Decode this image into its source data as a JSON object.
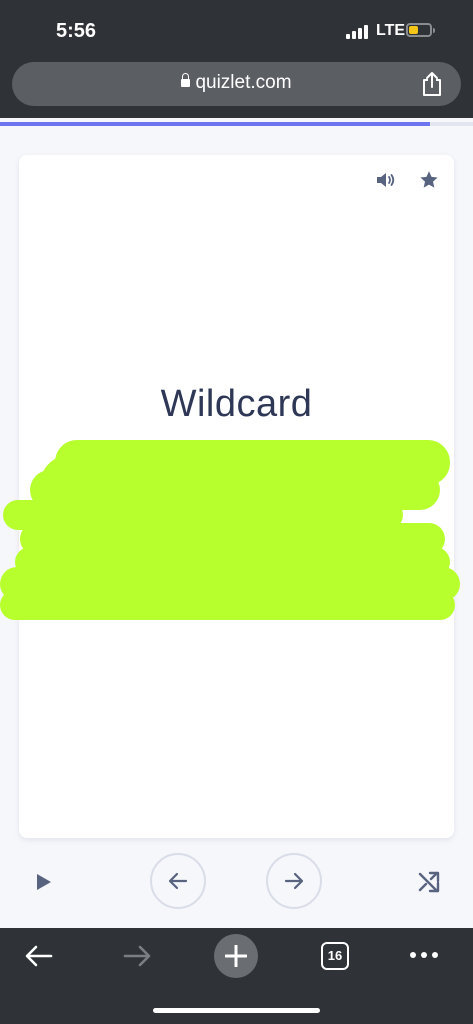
{
  "status_bar": {
    "time": "5:56",
    "network": "LTE",
    "battery_level": 0.45,
    "battery_color": "#f5c518"
  },
  "browser": {
    "url": "quizlet.com",
    "open_tabs": "16",
    "icons": [
      "lock-icon",
      "share-icon",
      "back-arrow-icon",
      "forward-arrow-icon",
      "plus-icon",
      "tabs-icon",
      "more-icon"
    ]
  },
  "progress": {
    "fraction": 0.91,
    "color": "#6d74f0"
  },
  "card": {
    "term": "Wildcard",
    "starred": false,
    "icons": [
      "audio-icon",
      "star-icon"
    ],
    "redaction_color": "#b8ff2e"
  },
  "controls": {
    "icons": [
      "play-icon",
      "arrow-left-icon",
      "arrow-right-icon",
      "shuffle-icon"
    ]
  },
  "colors": {
    "text_dark": "#2e3856",
    "icon_gray": "#586380",
    "toolbar_bg": "#2f3236"
  }
}
